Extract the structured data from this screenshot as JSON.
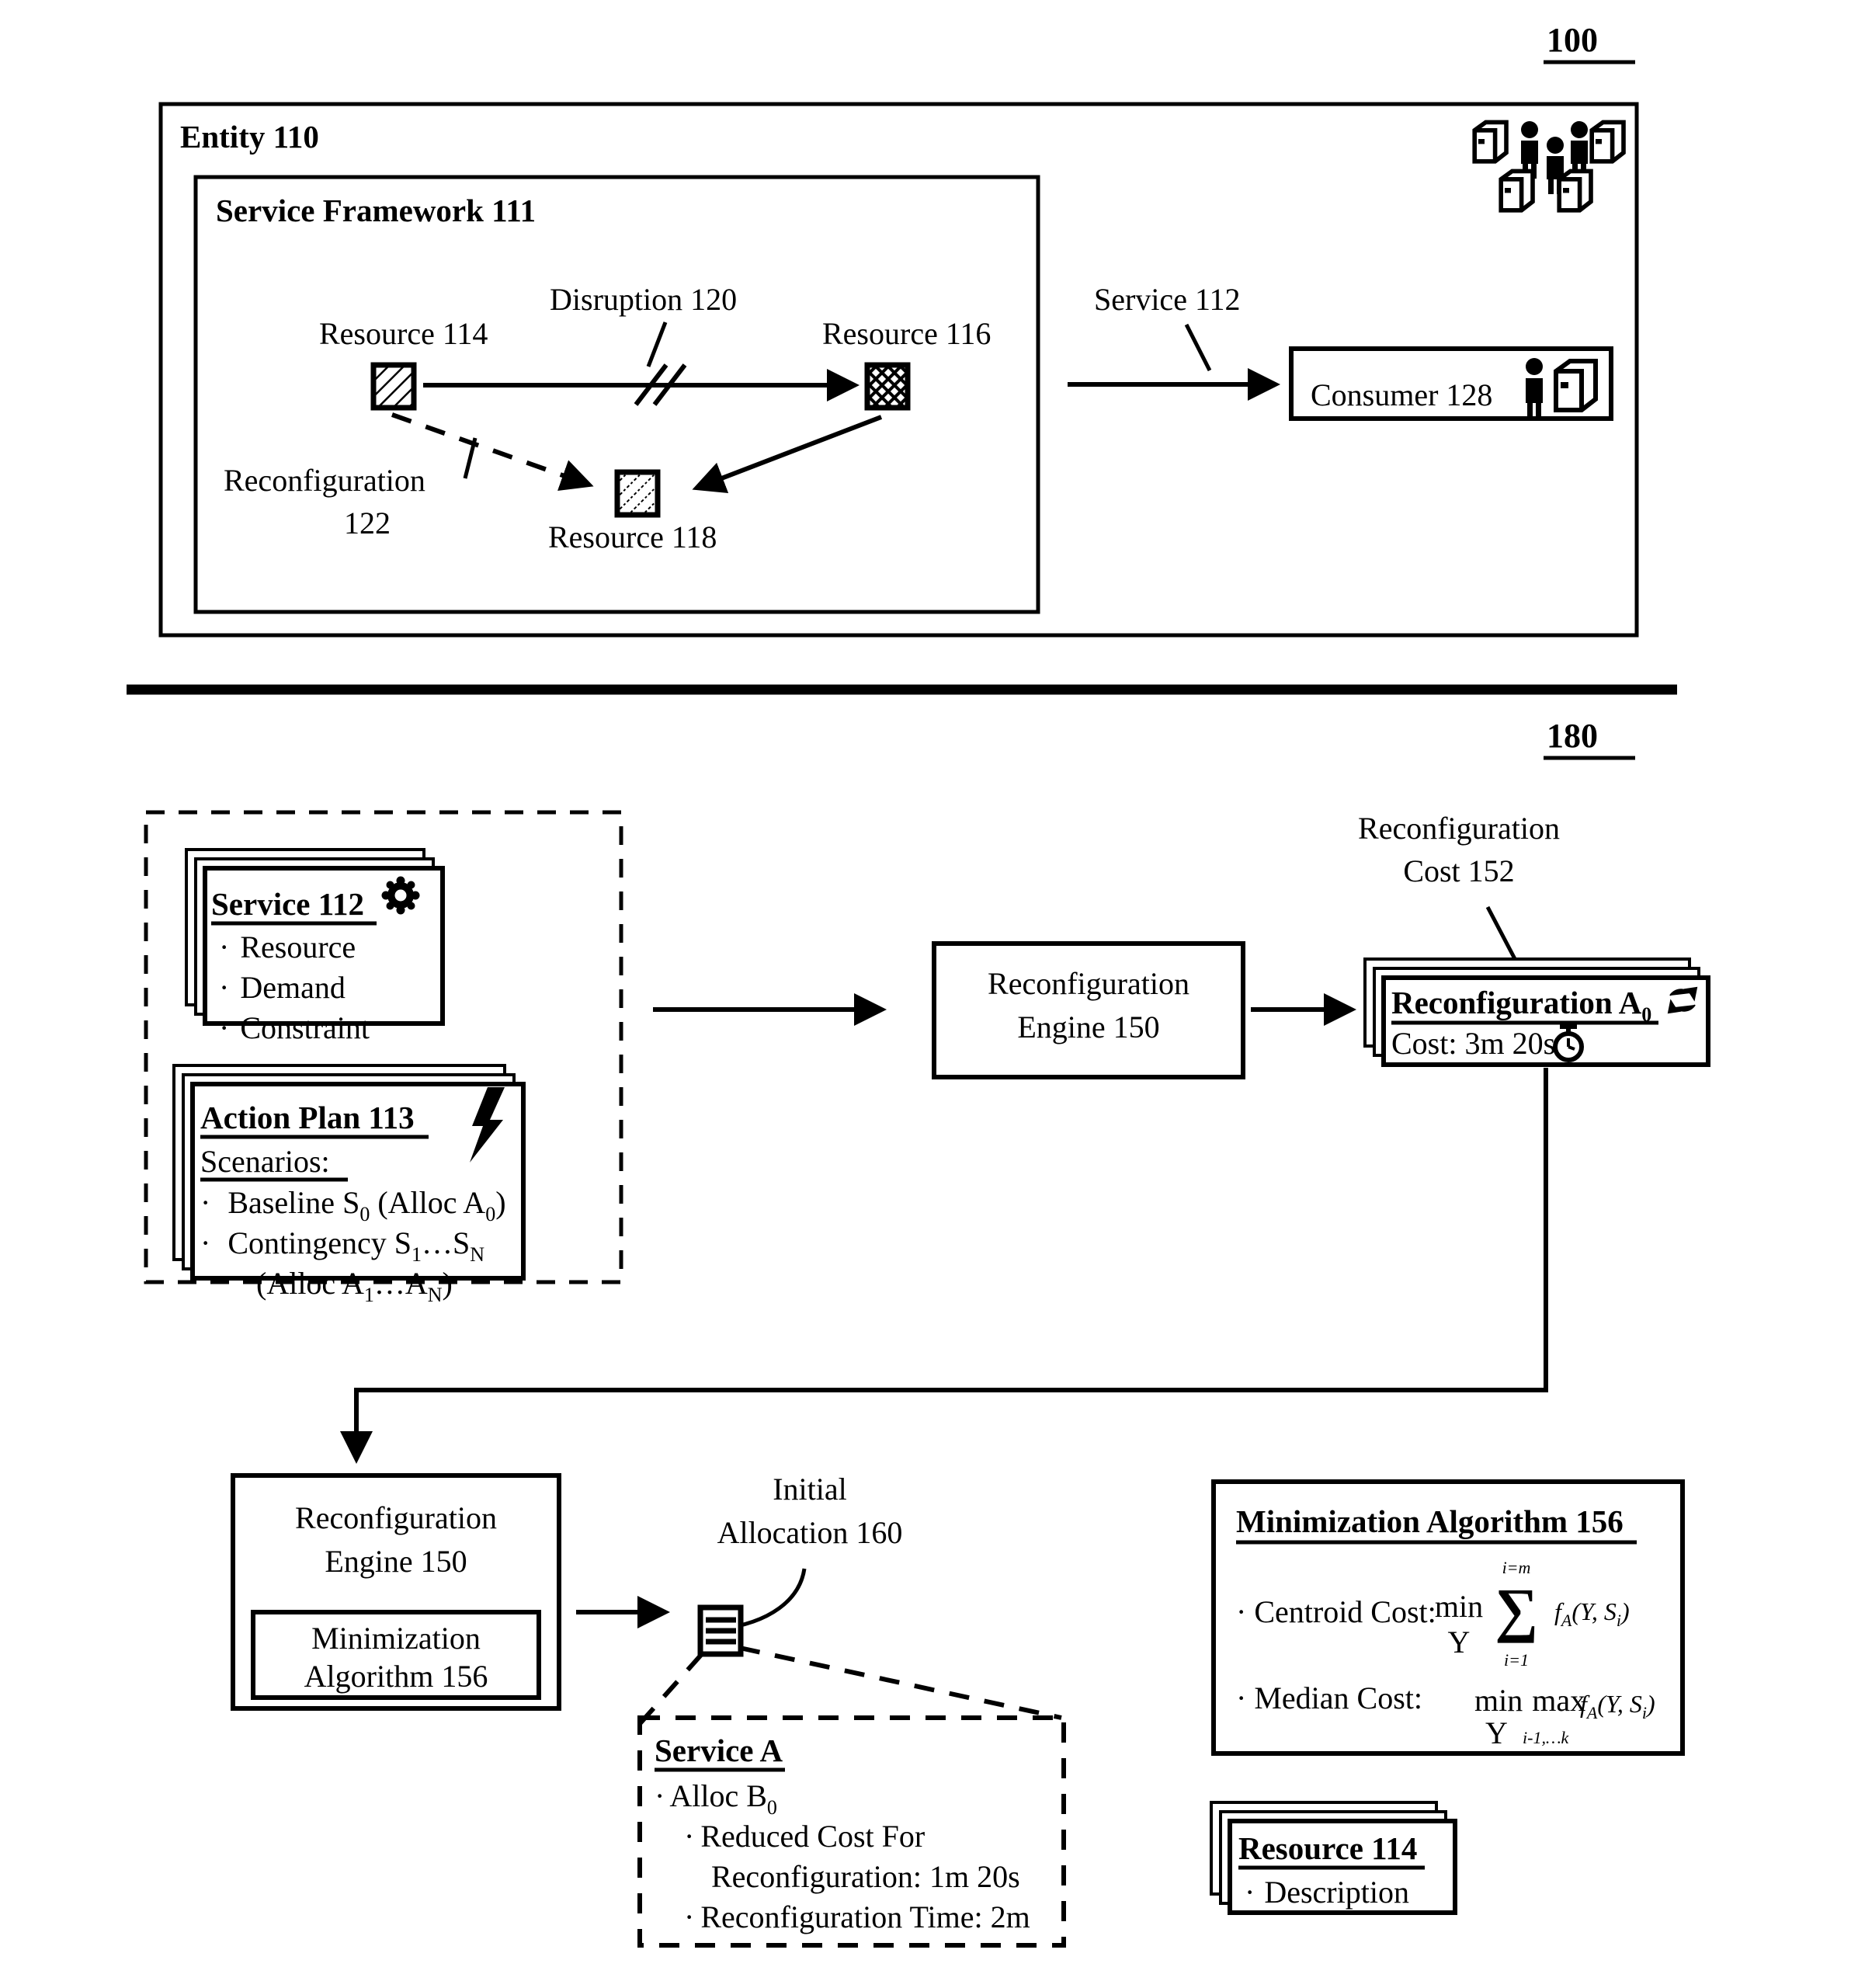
{
  "figure": {
    "top_number": "100",
    "bottom_number": "180"
  },
  "top_panel": {
    "entity_label": "Entity 110",
    "framework_label": "Service Framework 111",
    "resource_114_label": "Resource 114",
    "resource_116_label": "Resource 116",
    "resource_118_label": "Resource 118",
    "disruption_label": "Disruption 120",
    "reconfiguration_label_line1": "Reconfiguration",
    "reconfiguration_label_line2": "122",
    "service_label": "Service 112",
    "consumer_label": "Consumer 128",
    "icons": {
      "server": "server-icon",
      "person": "person-icon",
      "break": "break-marker-icon"
    }
  },
  "bottom_panel": {
    "service_card": {
      "title": "Service 112",
      "icon": "gear-icon",
      "bullets": [
        "Resource",
        "Demand",
        "Constraint"
      ]
    },
    "action_plan_card": {
      "title": "Action Plan 113",
      "icon": "lightning-bolt-icon",
      "subtitle": "Scenarios:",
      "line1_prefix": "Baseline S",
      "line1_sub": "0",
      "line1_suffix": "(Alloc A",
      "line1_sub2": "0",
      "line1_end": ")",
      "line2_prefix": "Contingency S",
      "line2_sub": "1",
      "line2_mid": "…S",
      "line2_sub2": "N",
      "line3_prefix": "(Alloc A",
      "line3_sub": "1",
      "line3_mid": "…A",
      "line3_sub2": "N",
      "line3_end": ")"
    },
    "engine_box_top": {
      "line1": "Reconfiguration",
      "line2": "Engine 150"
    },
    "reconfig_cost_label": {
      "line1": "Reconfiguration",
      "line2": "Cost 152"
    },
    "reconfig_card": {
      "title_prefix": "Reconfiguration A",
      "title_sub": "0",
      "icon_title": "refresh-cycle-icon",
      "cost_label": "Cost: 3m 20s",
      "icon_cost": "stopwatch-icon"
    },
    "engine_box_bottom": {
      "line1": "Reconfiguration",
      "line2": "Engine 150",
      "inner_line1": "Minimization",
      "inner_line2": "Algorithm 156"
    },
    "initial_allocation_label": {
      "line1": "Initial",
      "line2": "Allocation 160",
      "icon": "document-list-icon"
    },
    "service_a_card": {
      "title": "Service A",
      "b1_prefix": "Alloc B",
      "b1_sub": "0",
      "b2_line1": "Reduced Cost For",
      "b2_line2": "Reconfiguration:  1m 20s",
      "b3": "Reconfiguration Time: 2m"
    },
    "minimization_box": {
      "title": "Minimization Algorithm 156",
      "centroid_label": "Centroid Cost:",
      "centroid_min": "min",
      "centroid_minvar": "Y",
      "centroid_sum_upper": "i=m",
      "centroid_sum_lower": "i=1",
      "centroid_sigma": "∑",
      "centroid_fn_f": "f",
      "centroid_fn_sub": "A",
      "centroid_fn_args": "(Y, S",
      "centroid_fn_argsub": "i",
      "centroid_fn_end": ")",
      "median_label": "Median Cost:",
      "median_min": "min",
      "median_minvar": "Y",
      "median_max": "max",
      "median_maxsub": "i-1,…k",
      "median_fn_f": "f",
      "median_fn_sub": "A",
      "median_fn_args": "(Y, S",
      "median_fn_argsub": "i",
      "median_fn_end": ")"
    },
    "resource_card": {
      "title": "Resource 114",
      "bullet": "Description"
    }
  }
}
